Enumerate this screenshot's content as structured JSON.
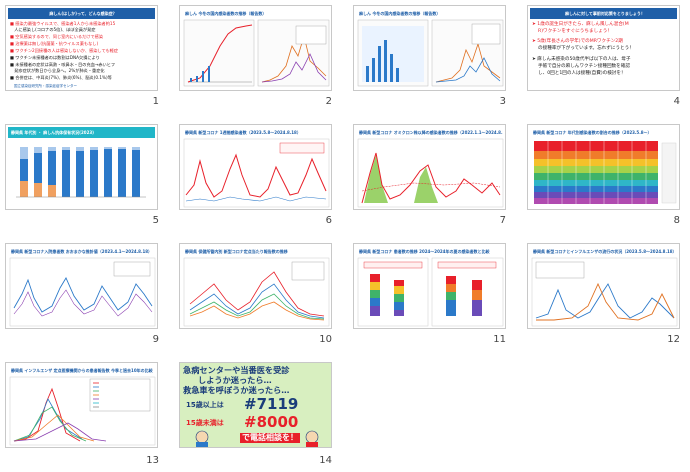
{
  "slides": [
    {
      "num": "1",
      "title": "麻しん(はしか)って、どんな感染症？",
      "lines": [
        "■ 感染力最強ウイルスで、感染者1人から未感染者約15",
        "　人に感染し(コロナの5倍)、ほぼ全員が発症",
        "■ 空気感染するので、同じ室内にいるだけで感染",
        "■ 治療薬は無し(抗菌薬・抗ウイルス薬もなし)",
        "■ ワクチン2回接種の人は感染しないか、感染しても軽症",
        "■ ワクチン未接種者のは数割はDNA欠損により",
        "■ 未接種者の症状は高熱・咳鼻水・目の充血→赤いヒフ",
        "　発疹症状が数日から全身へ。2%が肺炎・重症化",
        "■ 合併症は、中耳炎(7%)、肺炎(6%)、脳炎(0.1%)等"
      ],
      "footer": "国立感染症研究所・感染症疫学センター"
    },
    {
      "num": "2",
      "title": "麻しん 今冬の国内感染者数の推移（報告数）"
    },
    {
      "num": "3",
      "title": "麻しん 今冬の国内感染者数の推移（報告数）"
    },
    {
      "num": "4",
      "title": "麻しんに対して事前対応策をとりましょう！",
      "lines": [
        "➤ 1歳の誕生日がきたら、麻しん風しん混合(M",
        "　 R)ワクチンをすぐにうちましょう！",
        "➤ 5歳(年長さんの学年)でのMRワクチン2期",
        "　 の接種率が下がっています。忘れずにうとう！",
        "➤ 麻しん未感染の50歳代半ば以下の人は、母子",
        "　 手帳で自分の麻しんワクチン接種回数を確認",
        "　 し、0回と1回の人は接種(自費)の検討を！"
      ]
    },
    {
      "num": "5",
      "title": "静岡県 年代別 ・ 麻しん抗体保有状況(2023)"
    },
    {
      "num": "6",
      "title": "静岡県 新型コロナ 1週間感染者数（2023.5.8〜2024.8.18）"
    },
    {
      "num": "7",
      "title": "静岡県 新型コロナ オミクロン株以降の感染者数の推移（2022.1.1〜2024.8.18）"
    },
    {
      "num": "8",
      "title": "静岡県 新型コロナ 年代別感染者数の割合の推移（2023.5.8〜）"
    },
    {
      "num": "9",
      "title": "静岡県 新型コロナ入院患者数 おおまかな推計値（2023.4.1〜2024.8.18）"
    },
    {
      "num": "10",
      "title": "静岡県 保健所管内別 新型コロナ定点当たり報告数の推移"
    },
    {
      "num": "11",
      "title": "静岡県 新型コロナ 患者数の推移 2024〜2024年の夏の感染者数と比較"
    },
    {
      "num": "12",
      "title": "静岡県 新型コロナとインフルエンザの流行の状況（2023.5.8〜2024.8.18）"
    },
    {
      "num": "13",
      "title": "静岡県 インフルエンザ 定点医療機関からの患者報告数 今季と過去10年の比較"
    },
    {
      "num": "14",
      "lines": [
        "急病センターや当番医を受診",
        "しようか迷ったら…",
        "救急車を呼ぼうか迷ったら…",
        "15歳以上は",
        "#7119",
        "15歳未満は",
        "#8000",
        "で電話相談を！"
      ]
    }
  ],
  "colors": {
    "blue_header": "#1f5fa8",
    "teal_header": "#21b6c8",
    "red": "#e8202a",
    "dark_blue": "#1a3c7a",
    "green_bg": "#d8efc0"
  }
}
